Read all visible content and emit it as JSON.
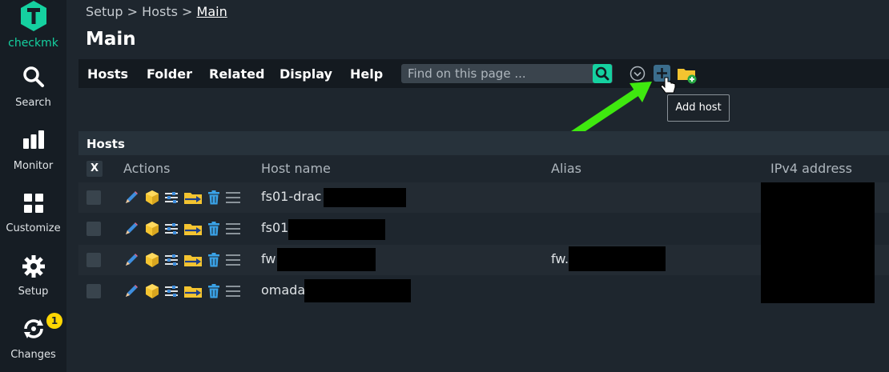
{
  "sidebar": {
    "logo_text": "checkmk",
    "items": [
      {
        "label": "Search",
        "icon": "search-icon"
      },
      {
        "label": "Monitor",
        "icon": "monitor-icon"
      },
      {
        "label": "Customize",
        "icon": "customize-icon"
      },
      {
        "label": "Setup",
        "icon": "gear-icon"
      },
      {
        "label": "Changes",
        "icon": "changes-icon",
        "badge": "1"
      }
    ]
  },
  "breadcrumb": {
    "items": [
      "Setup",
      "Hosts",
      "Main"
    ],
    "separator": ">"
  },
  "page": {
    "title": "Main"
  },
  "menu": {
    "items": [
      "Hosts",
      "Folder",
      "Related",
      "Display",
      "Help"
    ],
    "search_placeholder": "Find on this page ...",
    "tooltip": "Add host"
  },
  "table": {
    "title": "Hosts",
    "select_all_label": "X",
    "columns": [
      "Actions",
      "Host name",
      "Alias",
      "IPv4 address"
    ],
    "rows": [
      {
        "host": "fs01-drac",
        "alias": ""
      },
      {
        "host": "fs01",
        "alias": ""
      },
      {
        "host": "fw",
        "alias": "fw."
      },
      {
        "host": "omada",
        "alias": ""
      }
    ]
  },
  "colors": {
    "accent": "#15d1a0",
    "background": "#1e262e",
    "sidebar": "#161d24",
    "badge": "#ffd703",
    "annotation_arrow": "#3fe80f"
  }
}
